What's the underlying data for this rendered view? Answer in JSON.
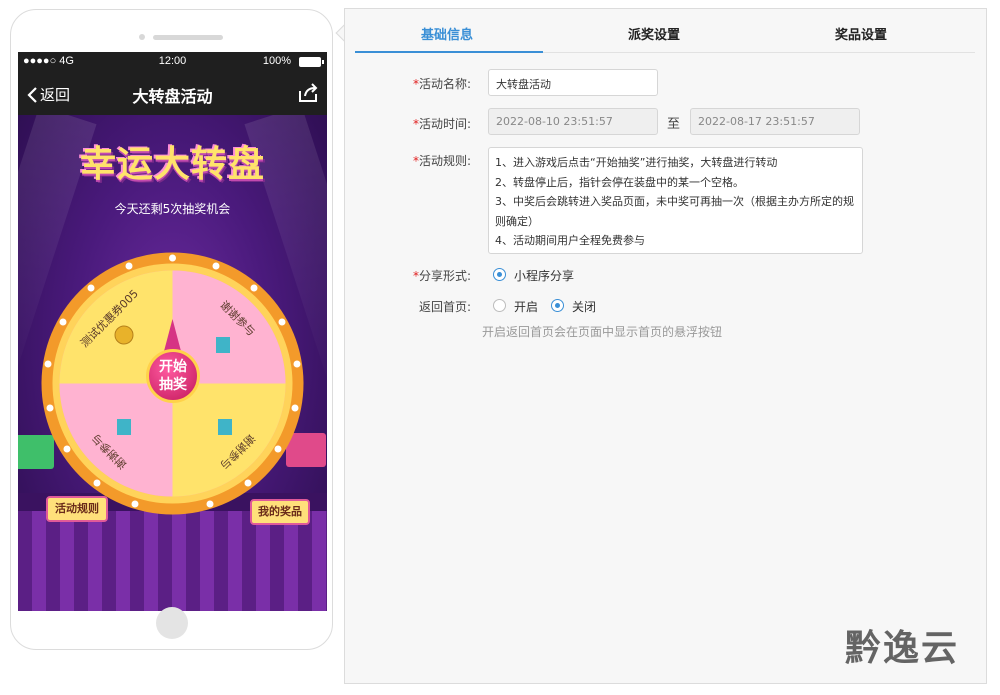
{
  "phone": {
    "status": {
      "signal": "●●●●○ 4G",
      "time": "12:00",
      "battery": "100%"
    },
    "nav": {
      "back_label": "返回",
      "title": "大转盘活动"
    },
    "game": {
      "logo": "幸运大转盘",
      "chance_text": "今天还剩5次抽奖机会",
      "wheel_segments": [
        "测试优惠券005",
        "谢谢参与",
        "谢谢参与",
        "谢谢参与"
      ],
      "center_label_line1": "开始",
      "center_label_line2": "抽奖",
      "rules_button": "活动规则",
      "prize_button": "我的奖品"
    }
  },
  "tabs": [
    {
      "label": "基础信息",
      "active": true
    },
    {
      "label": "派奖设置",
      "active": false
    },
    {
      "label": "奖品设置",
      "active": false
    }
  ],
  "form": {
    "name": {
      "label": "活动名称:",
      "value": "大转盘活动"
    },
    "time": {
      "label": "活动时间:",
      "start": "2022-08-10 23:51:57",
      "separator": "至",
      "end": "2022-08-17 23:51:57"
    },
    "rules": {
      "label": "活动规则:",
      "text": "1、进入游戏后点击“开始抽奖”进行抽奖，大转盘进行转动\n2、转盘停止后，指针会停在装盘中的某一个空格。\n3、中奖后会跳转进入奖品页面，未中奖可再抽一次（根据主办方所定的规则确定）\n4、活动期间用户全程免费参与"
    },
    "share": {
      "label": "分享形式:",
      "option": "小程序分享"
    },
    "home": {
      "label": "返回首页:",
      "option_open": "开启",
      "option_close": "关闭",
      "hint": "开启返回首页会在页面中显示首页的悬浮按钮"
    }
  },
  "watermark": "黔逸云",
  "colors": {
    "accent": "#3a8fd6",
    "required": "#e02020"
  }
}
